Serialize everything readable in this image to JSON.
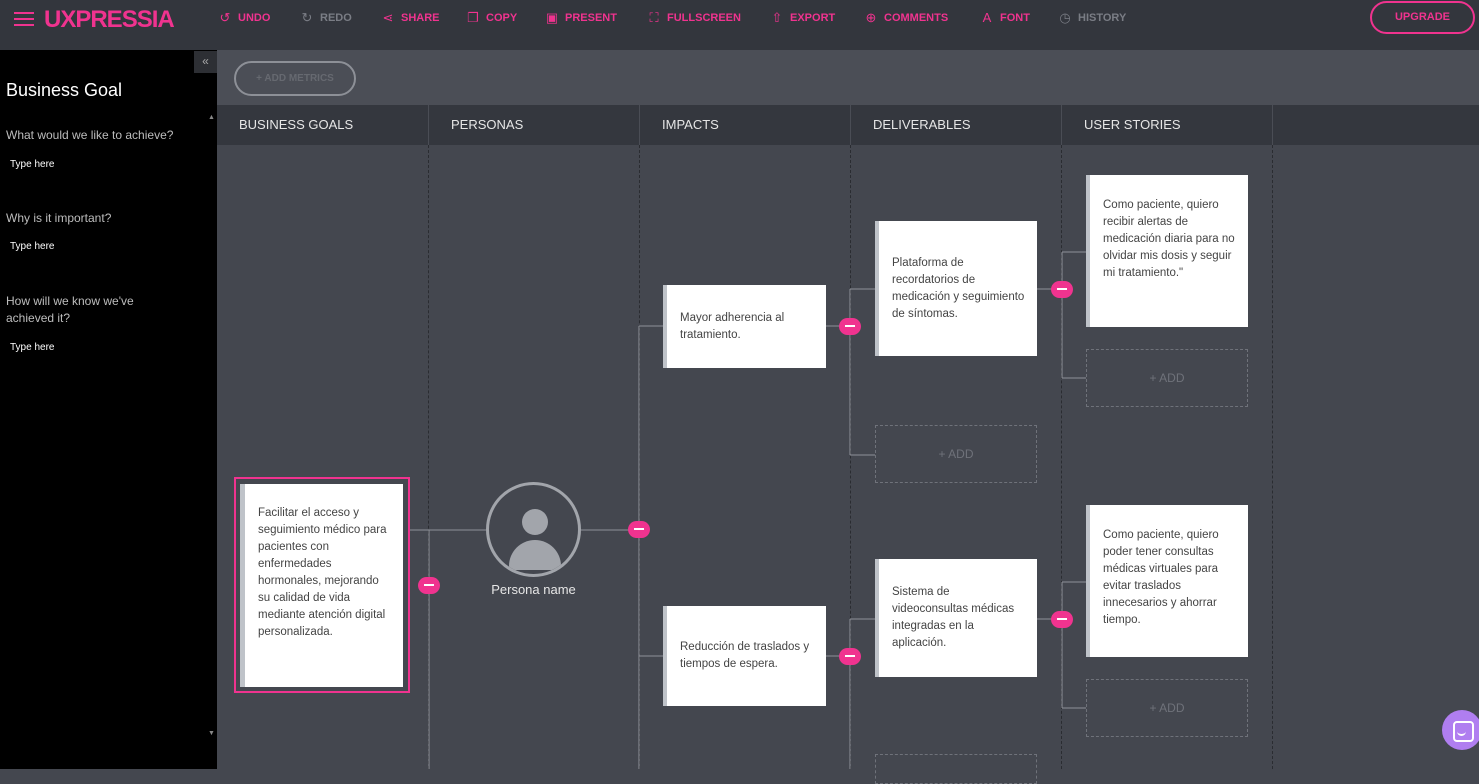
{
  "app": {
    "logo": "UXPRESSIA",
    "accent_color": "#f0338f"
  },
  "toolbar": {
    "undo": {
      "label": "UNDO",
      "icon": "undo-icon",
      "enabled": true
    },
    "redo": {
      "label": "REDO",
      "icon": "redo-icon",
      "enabled": false
    },
    "share": {
      "label": "SHARE",
      "icon": "share-icon",
      "enabled": true
    },
    "copy": {
      "label": "COPY",
      "icon": "copy-icon",
      "enabled": true
    },
    "present": {
      "label": "PRESENT",
      "icon": "present-icon",
      "enabled": true
    },
    "fullscreen": {
      "label": "FULLSCREEN",
      "icon": "fullscreen-icon",
      "enabled": true
    },
    "export": {
      "label": "EXPORT",
      "icon": "export-icon",
      "enabled": true
    },
    "comments": {
      "label": "COMMENTS",
      "icon": "comments-icon",
      "enabled": true
    },
    "font": {
      "label": "FONT",
      "icon": "font-icon",
      "enabled": true
    },
    "history": {
      "label": "HISTORY",
      "icon": "history-icon",
      "enabled": false
    },
    "upgrade": "UPGRADE"
  },
  "sidebar": {
    "title": "Business Goal",
    "questions": [
      {
        "question": "What would we like to achieve?",
        "answer_placeholder": "Type here"
      },
      {
        "question": "Why is it important?",
        "answer_placeholder": "Type here"
      },
      {
        "question": "How will we know we've achieved it?",
        "answer_placeholder": "Type here"
      }
    ]
  },
  "metrics": {
    "add_label": "+ ADD METRICS"
  },
  "columns": [
    "BUSINESS GOALS",
    "PERSONAS",
    "IMPACTS",
    "DELIVERABLES",
    "USER STORIES"
  ],
  "business_goal": "Facilitar el acceso y seguimiento médico para pacientes con enfermedades hormonales, mejorando su calidad de vida mediante atención digital personalizada.",
  "persona": {
    "name": "Persona name"
  },
  "impacts": [
    "Mayor adherencia al tratamiento.",
    "Reducción de traslados y tiempos de espera."
  ],
  "deliverables": [
    "Plataforma de recordatorios de medicación y seguimiento de síntomas.",
    "Sistema de videoconsultas médicas integradas en la aplicación."
  ],
  "user_stories": [
    "Como paciente, quiero recibir alertas de medicación diaria para no olvidar mis dosis y seguir mi tratamiento.\"",
    "Como paciente, quiero poder tener consultas médicas virtuales para evitar traslados innecesarios y ahorrar tiempo."
  ],
  "add_label": "+ ADD"
}
